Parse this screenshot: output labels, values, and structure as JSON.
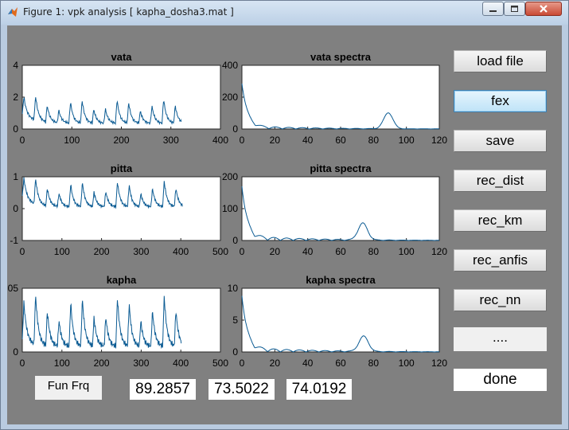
{
  "window": {
    "title": "Figure 1: vpk analysis [ kapha_dosha3.mat ]"
  },
  "buttons": {
    "load_file": "load file",
    "fex": "fex",
    "save": "save",
    "rec_dist": "rec_dist",
    "rec_km": "rec_km",
    "rec_anfis": "rec_anfis",
    "rec_nn": "rec_nn",
    "more": "....",
    "done": "done"
  },
  "fun_frq": {
    "label": "Fun Frq",
    "values": [
      "89.2857",
      "73.5022",
      "74.0192"
    ]
  },
  "colors": {
    "line": "#0b5b93",
    "figure_bg": "#808080"
  },
  "chart_data": [
    {
      "type": "line",
      "title": "vata",
      "xlim": [
        0,
        400
      ],
      "ylim": [
        0,
        4
      ],
      "xticks": [
        "0",
        "100",
        "200",
        "300",
        "400"
      ],
      "yticks": [
        "0",
        "2",
        "4"
      ],
      "signal": {
        "kind": "oscillation",
        "n": 322,
        "period": 23.5,
        "base": 0.35,
        "amp": 1.55,
        "drift_start": 0.6,
        "drift_end": 0.25
      }
    },
    {
      "type": "line",
      "title": "vata spectra",
      "xlim": [
        0,
        120
      ],
      "ylim": [
        0,
        400
      ],
      "xticks": [
        "0",
        "20",
        "40",
        "60",
        "80",
        "100",
        "120"
      ],
      "yticks": [
        "0",
        "200",
        "400"
      ],
      "signal": {
        "kind": "spectrum",
        "dc": 285,
        "dc_decay": 3.2,
        "ripple": 38,
        "ripple_period": 8.2,
        "peak_center": 89,
        "peak_height": 100,
        "peak_width": 4
      }
    },
    {
      "type": "line",
      "title": "pitta",
      "xlim": [
        0,
        500
      ],
      "ylim": [
        -1,
        1
      ],
      "xticks": [
        "0",
        "100",
        "200",
        "300",
        "400",
        "500"
      ],
      "yticks": [
        "-1",
        "0",
        "1"
      ],
      "signal": {
        "kind": "oscillation",
        "n": 405,
        "period": 29.5,
        "base": 0.05,
        "amp": 0.82,
        "drift_start": 0.35,
        "drift_end": 0.0
      }
    },
    {
      "type": "line",
      "title": "pitta spectra",
      "xlim": [
        0,
        120
      ],
      "ylim": [
        0,
        200
      ],
      "xticks": [
        "0",
        "20",
        "40",
        "60",
        "80",
        "100",
        "120"
      ],
      "yticks": [
        "0",
        "100",
        "200"
      ],
      "signal": {
        "kind": "spectrum",
        "dc": 170,
        "dc_decay": 3.0,
        "ripple": 28,
        "ripple_period": 7.8,
        "peak_center": 73.5,
        "peak_height": 53,
        "peak_width": 4
      }
    },
    {
      "type": "line",
      "title": "kapha",
      "xlim": [
        0,
        500
      ],
      "ylim": [
        0,
        0.05
      ],
      "xticks": [
        "0",
        "100",
        "200",
        "300",
        "400",
        "500"
      ],
      "yticks": [
        "0",
        "05"
      ],
      "signal": {
        "kind": "oscillation",
        "n": 402,
        "period": 29.5,
        "base": 0.004,
        "amp": 0.04,
        "drift_start": 0.006,
        "drift_end": 0.0
      }
    },
    {
      "type": "line",
      "title": "kapha spectra",
      "xlim": [
        0,
        120
      ],
      "ylim": [
        0,
        10
      ],
      "xticks": [
        "0",
        "20",
        "40",
        "60",
        "80",
        "100",
        "120"
      ],
      "yticks": [
        "0",
        "5",
        "10"
      ],
      "signal": {
        "kind": "spectrum",
        "dc": 8.8,
        "dc_decay": 3.0,
        "ripple": 1.4,
        "ripple_period": 7.8,
        "peak_center": 74,
        "peak_height": 2.4,
        "peak_width": 4
      }
    }
  ]
}
